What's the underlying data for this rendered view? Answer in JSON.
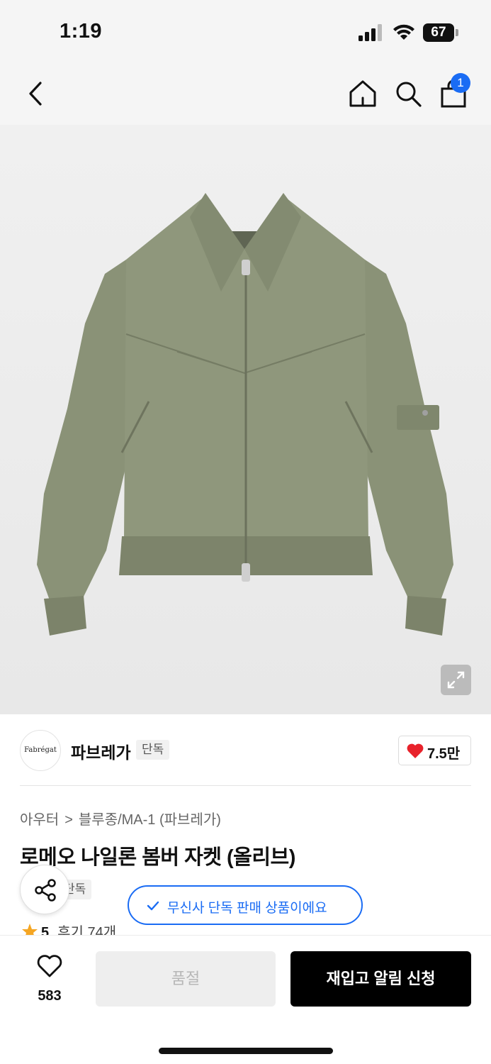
{
  "status_bar": {
    "time": "1:19",
    "battery": "67"
  },
  "nav": {
    "cart_count": "1"
  },
  "brand": {
    "logo_text": "Fabrégat",
    "name": "파브레가",
    "tag": "단독",
    "likes": "7.5만"
  },
  "breadcrumb": {
    "category": "아우터",
    "separator": ">",
    "subcategory": "블루종/MA-1 (파브레가)"
  },
  "product": {
    "title": "로메오 나일론 봄버 자켓 (올리브)",
    "tag": "단독",
    "rating": "5",
    "reviews": "후기 74개"
  },
  "notice": {
    "text": "무신사 단독 판매 상품이에요"
  },
  "bottom_bar": {
    "wish_count": "583",
    "soldout_label": "품절",
    "restock_label": "재입고 알림 신청"
  },
  "colors": {
    "accent": "#1a6cf4",
    "heart": "#e8222b",
    "jacket": "#8b9378",
    "star": "#f5a623"
  }
}
